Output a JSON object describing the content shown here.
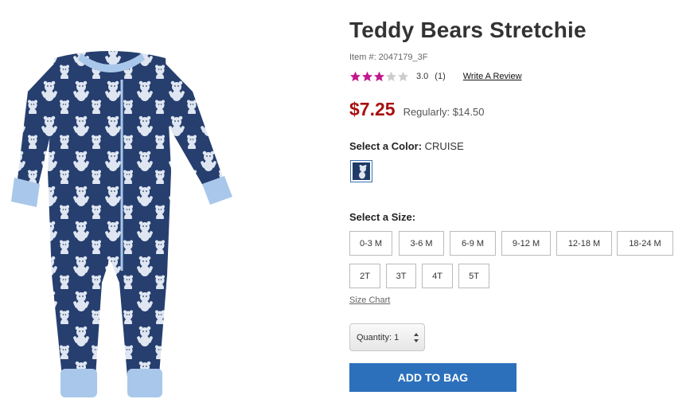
{
  "product": {
    "title": "Teddy Bears Stretchie",
    "item_number": "Item #: 2047179_3F",
    "image_icon": "stretchie-product-image"
  },
  "rating": {
    "value": 3.0,
    "value_text": "3.0",
    "max": 5,
    "count_text": "(1)",
    "write_review_label": "Write A Review",
    "filled_color": "#c2168c",
    "empty_color": "#cccccc"
  },
  "price": {
    "sale": "$7.25",
    "regular": "Regularly: $14.50",
    "sale_color": "#a81010"
  },
  "color_select": {
    "label": "Select a Color:",
    "selected": "CRUISE"
  },
  "size_select": {
    "label": "Select a Size:",
    "sizes": [
      "0-3 M",
      "3-6 M",
      "6-9 M",
      "9-12 M",
      "12-18 M",
      "18-24 M",
      "2T",
      "3T",
      "4T",
      "5T"
    ],
    "size_chart_label": "Size Chart"
  },
  "quantity": {
    "label": "Quantity: 1"
  },
  "add_to_bag": {
    "label": "ADD TO BAG",
    "color": "#2c70bc"
  }
}
